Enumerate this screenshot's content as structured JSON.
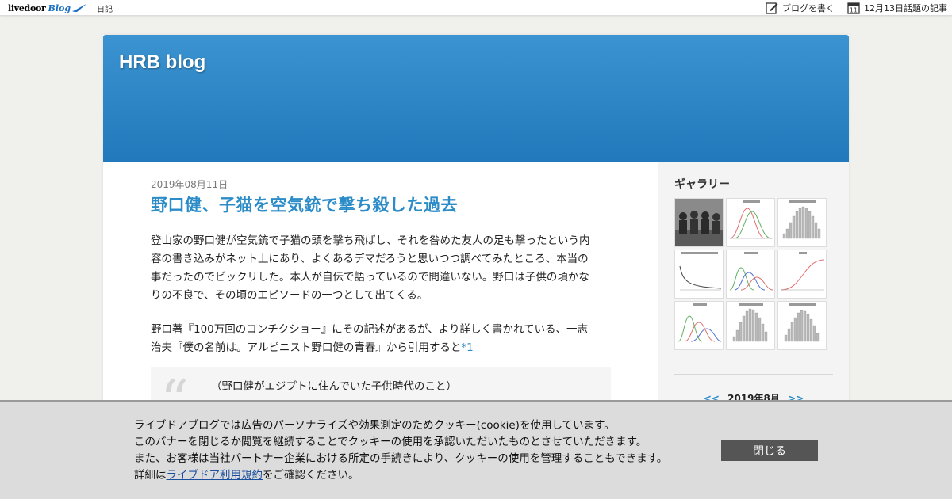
{
  "topbar": {
    "logo_livedoor": "livedoor",
    "logo_blog": "Blog",
    "category": "日記",
    "write_blog": "ブログを書く",
    "calendar_day": "11",
    "trending": "12月13日話題の記事"
  },
  "header": {
    "blog_title": "HRB blog",
    "color_top": "#3b93d1",
    "color_bottom": "#2279bb"
  },
  "article": {
    "date": "2019年08月11日",
    "title": "野口健、子猫を空気銃で撃ち殺した過去",
    "para1": [
      "登山家の野口健が空気銃で子猫の頭を撃ち飛ばし、それを咎めた友人の足も撃ったという内",
      "容の書き込みがネット上にあり、よくあるデマだろうと思いつつ調べてみたところ、本当の",
      "事だったのでビックリした。本人が自伝で語っているので間違いない。野口は子供の頃かな",
      "りの不良で、その頃のエピソードの一つとして出てくる。"
    ],
    "para2_line1": "野口著『100万回のコンチクショー』にその記述があるが、より詳しく書かれている、一志",
    "para2_line2": "治夫『僕の名前は。アルピニスト野口健の青春』から引用すると",
    "footnote": "*1",
    "quote_mark": "“",
    "quote_line1": "（野口健がエジプトに住んでいた子供時代のこと）"
  },
  "sidebar": {
    "gallery_heading": "ギャラリー",
    "calendar_prev": "<<",
    "calendar_month": "2019年8月",
    "calendar_next": ">>"
  },
  "cookie": {
    "line1": "ライブドアブログでは広告のパーソナライズや効果測定のためクッキー(cookie)を使用しています。",
    "line2": "このバナーを閉じるか閲覧を継続することでクッキーの使用を承認いただいたものとさせていただきます。",
    "line3": "また、お客様は当社パートナー企業における所定の手続きにより、クッキーの使用を管理することもできます。",
    "line4_prefix": "詳細は",
    "line4_link": "ライブドア利用規約",
    "line4_suffix": "をご確認ください。",
    "close_label": "閉じる"
  },
  "colors": {
    "accent": "#2c8cc8",
    "cookie_bg": "#dcdcdc",
    "close_button": "#555555"
  }
}
